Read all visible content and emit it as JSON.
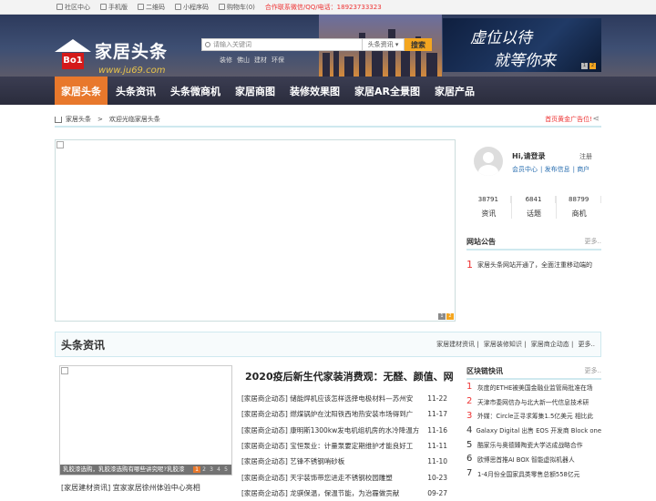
{
  "topbar": {
    "items": [
      "社区中心",
      "手机版",
      "二维码",
      "小程序码",
      "购物车(0)"
    ],
    "contact": "合作联系微信/QQ/电话：18923733323"
  },
  "logo": {
    "title": "家居头条",
    "badge": "Bo1",
    "url": "www.ju69.com"
  },
  "search": {
    "placeholder": "请输入关键词",
    "scope": "头条资讯",
    "button": "搜索"
  },
  "hot_keywords": [
    "装修",
    "佛山",
    "建材",
    "环保"
  ],
  "banner": {
    "line1": "虚位以待",
    "line2": "就等你来",
    "pages": [
      "1",
      "2"
    ]
  },
  "nav": [
    "家居头条",
    "头条资讯",
    "头条微商机",
    "家居商图",
    "装修效果图",
    "家居AR全景图",
    "家居产品"
  ],
  "breadcrumb": {
    "home": "家居头条",
    "sep": ">",
    "current": "欢迎光临家居头条",
    "ad": "首页黄金广告位!"
  },
  "slider": {
    "pages": [
      "1",
      "2"
    ]
  },
  "user": {
    "greeting": "Hi,请登录",
    "register": "注册",
    "links": [
      "会员中心",
      "发布信息",
      "商户"
    ]
  },
  "stats": [
    {
      "num": "38791",
      "label": "资讯"
    },
    {
      "num": "6841",
      "label": "话题"
    },
    {
      "num": "88799",
      "label": "商机"
    }
  ],
  "notice": {
    "title": "网站公告",
    "more": "更多..",
    "rank": "1",
    "text": "家居头条网站开通了，全面注重移动端的"
  },
  "section": {
    "title": "头条资讯",
    "tags": [
      "家居建材资讯",
      "家居装修知识",
      "家居商企动态",
      "更多.."
    ]
  },
  "photo": {
    "caption": "乳胶漆选购，乳胶漆选购有哪些讲究呢?乳胶漆",
    "pages": [
      "1",
      "2",
      "3",
      "4",
      "5"
    ],
    "below": "[家居建材资讯] 宜家家居徐州体验中心亮相"
  },
  "headline": "2020疫后新生代家装消费观：无醛、颜值、网",
  "news": [
    {
      "t": "[家居商企动态] 储能焊机应该怎样选择电极材料—苏州安",
      "d": "11-22"
    },
    {
      "t": "[家居商企动态] 燃煤锅炉在沈阳铁西地热安装市场得到广",
      "d": "11-17"
    },
    {
      "t": "[家居商企动态] 康明斯1300kw发电机组机房的水冷降温方",
      "d": "11-16"
    },
    {
      "t": "[家居商企动态] 宝恒泵业：计量泵要定期维护才能良好工",
      "d": "11-11"
    },
    {
      "t": "[家居商企动态] 艺锋不锈钢哨砂板",
      "d": "11-10"
    },
    {
      "t": "[家居商企动态] 天宇装饰带您进走不锈钢校园雕塑",
      "d": "10-23"
    },
    {
      "t": "[家居商企动态] 龙骐保温，保温节能，为治霾做贡献",
      "d": "09-27"
    }
  ],
  "blockchain": {
    "title": "区块链快讯",
    "more": "更多..",
    "items": [
      "1 灰度的ETHE被美国金融业监管局批准在场",
      "2 天津市委网信办与北大新一代信息技术研",
      "3 外媒：Circle正寻求筹集1.5亿美元 相比此",
      "4 Galaxy Digital 出售 EOS 开发商 Block one",
      "5 酷家乐与奥德臻陶瓷大学达成战略合作",
      "6 欧博思首推AI BOX 智能虚拟机器人",
      "7 1-4月份全国家具类零售总额558亿元"
    ]
  }
}
